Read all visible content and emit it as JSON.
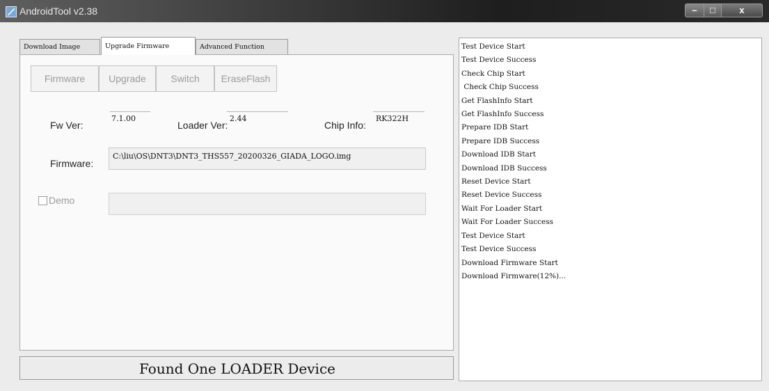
{
  "window": {
    "title": "AndroidTool v2.38",
    "controls": {
      "minimize": "–",
      "maximize": "□",
      "close": "x"
    }
  },
  "tabs": [
    {
      "label": "Download Image",
      "active": false
    },
    {
      "label": "Upgrade Firmware",
      "active": true
    },
    {
      "label": "Advanced Function",
      "active": false
    }
  ],
  "buttons": {
    "firmware": "Firmware",
    "upgrade": "Upgrade",
    "switch": "Switch",
    "erase_flash": "EraseFlash"
  },
  "info": {
    "fw_ver_label": "Fw Ver:",
    "fw_ver_value": "7.1.00",
    "loader_ver_label": "Loader Ver:",
    "loader_ver_value": "2.44",
    "chip_info_label": "Chip Info:",
    "chip_info_value": "RK322H"
  },
  "firmware": {
    "label": "Firmware:",
    "path": "C:\\liu\\OS\\DNT3\\DNT3_THS557_20200326_GIADA_LOGO.img"
  },
  "demo": {
    "label": "Demo",
    "checked": false,
    "value": ""
  },
  "status": "Found One LOADER Device",
  "log": [
    "Test Device Start",
    "Test Device Success",
    "Check Chip Start",
    " Check Chip Success",
    "Get FlashInfo Start",
    "Get FlashInfo Success",
    "Prepare IDB Start",
    "Prepare IDB Success",
    "Download IDB Start",
    "Download IDB Success",
    "Reset Device Start",
    "Reset Device Success",
    "Wait For Loader Start",
    "Wait For Loader Success",
    "Test Device Start",
    "Test Device Success",
    "Download Firmware Start",
    "Download Firmware(12%)..."
  ]
}
